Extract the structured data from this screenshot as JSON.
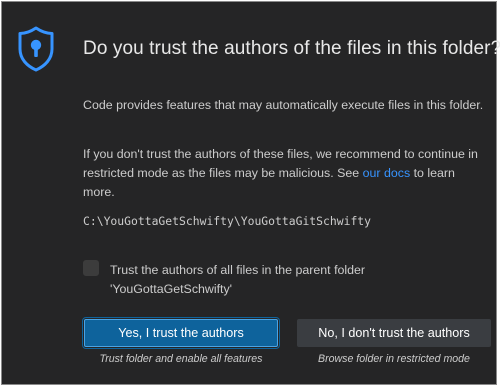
{
  "dialog": {
    "icon": "shield-lock-icon",
    "title": "Do you trust the authors of the files in this folder?",
    "paragraph1": "Code provides features that may automatically execute files in this folder.",
    "paragraph2_before": "If you don't trust the authors of these files, we recommend to continue in restricted mode as the files may be malicious. See ",
    "paragraph2_link": "our docs",
    "paragraph2_after": " to learn more.",
    "folder_path": "C:\\YouGottaGetSchwifty\\YouGottaGitSchwifty",
    "checkbox": {
      "checked": false,
      "label": "Trust the authors of all files in the parent folder 'YouGottaGetSchwifty'"
    },
    "buttons": {
      "trust_label": "Yes, I trust the authors",
      "trust_caption": "Trust folder and enable all features",
      "distrust_label": "No, I don't trust the authors",
      "distrust_caption": "Browse folder in restricted mode"
    }
  },
  "colors": {
    "background": "#252526",
    "primary_button": "#0e639c",
    "secondary_button": "#3a3d41",
    "link": "#3794ff",
    "icon": "#3794ff"
  }
}
